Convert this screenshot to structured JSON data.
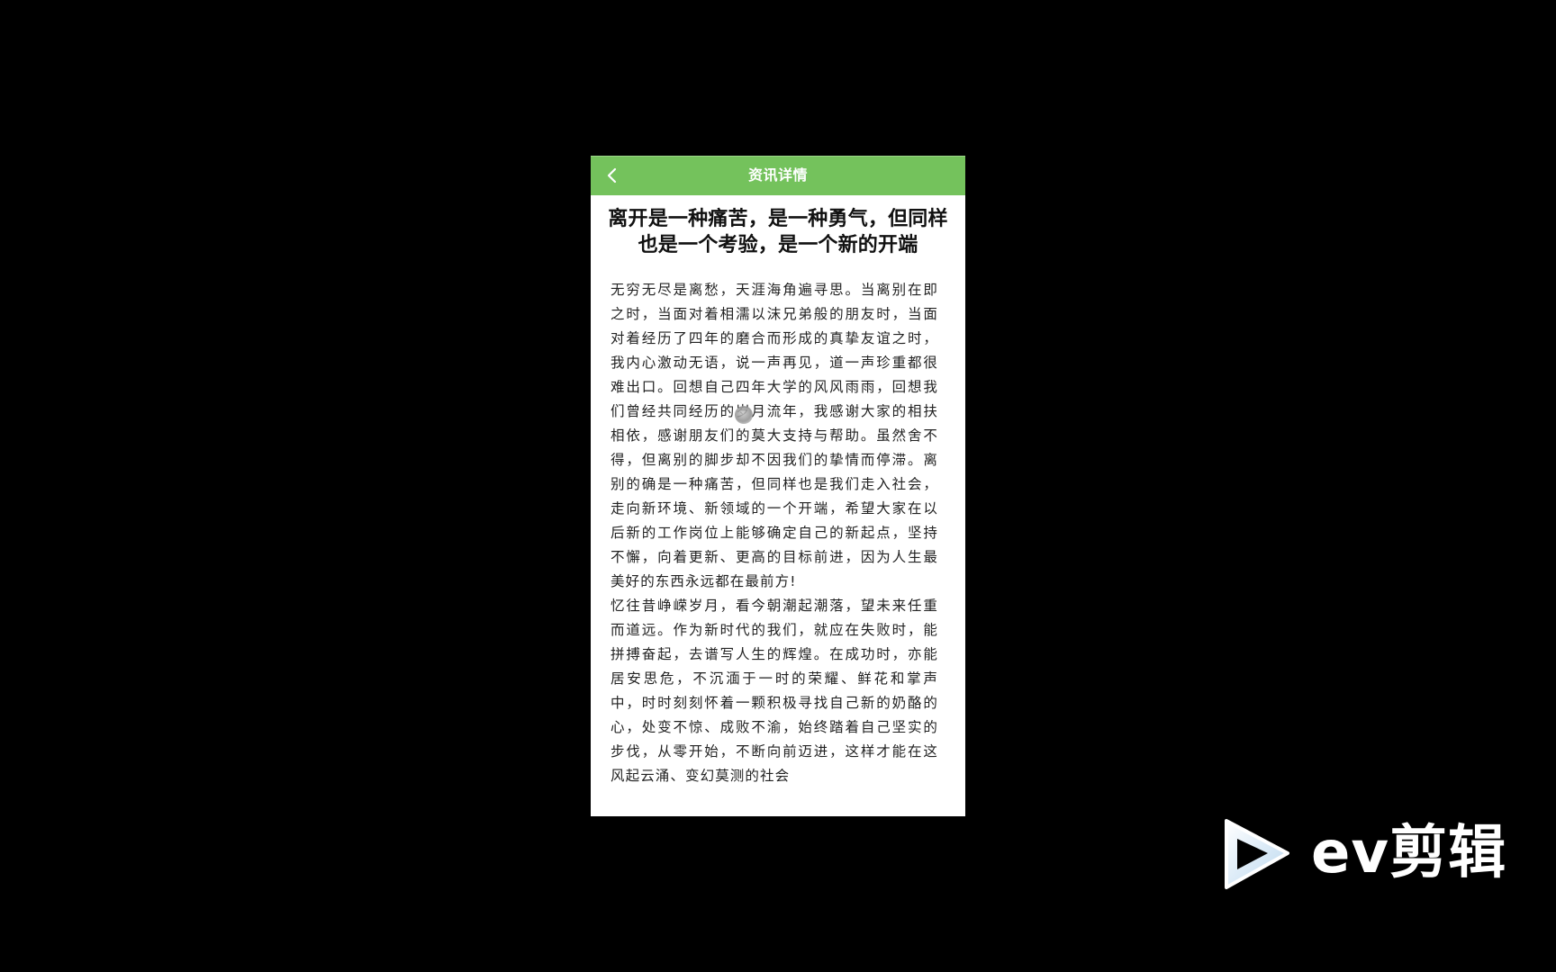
{
  "header": {
    "title": "资讯详情",
    "back_icon": "chevron-left-icon",
    "background_color": "#74c25c"
  },
  "article": {
    "title": "离开是一种痛苦，是一种勇气，但同样也是一个考验，是一个新的开端",
    "paragraphs": [
      "无穷无尽是离愁，天涯海角遍寻思。当离别在即之时，当面对着相濡以沫兄弟般的朋友时，当面对着经历了四年的磨合而形成的真挚友谊之时，我内心激动无语，说一声再见，道一声珍重都很难出口。回想自己四年大学的风风雨雨，回想我们曾经共同经历的岁月流年，我感谢大家的相扶相依，感谢朋友们的莫大支持与帮助。虽然舍不得，但离别的脚步却不因我们的挚情而停滞。离别的确是一种痛苦，但同样也是我们走入社会，走向新环境、新领域的一个开端，希望大家在以后新的工作岗位上能够确定自己的新起点，坚持不懈，向着更新、更高的目标前进，因为人生最美好的东西永远都在最前方!",
      "忆往昔峥嵘岁月，看今朝潮起潮落，望未来任重而道远。作为新时代的我们，就应在失败时，能拼搏奋起，去谱写人生的辉煌。在成功时，亦能居安思危，不沉湎于一时的荣耀、鲜花和掌声中，时时刻刻怀着一颗积极寻找自己新的奶酪的心，处变不惊、成败不渝，始终踏着自己坚实的步伐，从零开始，不断向前迈进，这样才能在这风起云涌、变幻莫测的社会"
    ]
  },
  "watermark": {
    "logo_icon": "play-triangle-icon",
    "text": "ev剪辑"
  }
}
